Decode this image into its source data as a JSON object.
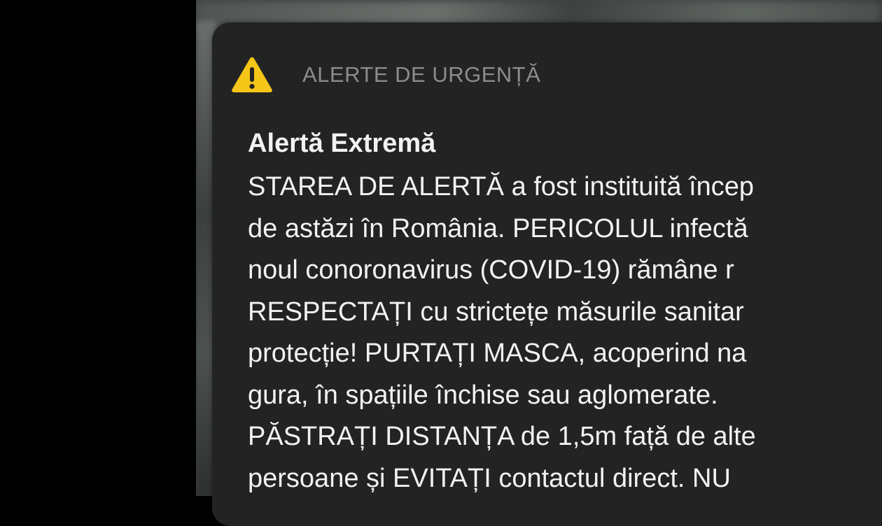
{
  "notification": {
    "app_name": "ALERTE DE URGENȚĂ",
    "icon": "warning-triangle-icon",
    "accent_color": "#f5c518",
    "title": "Alertă Extremă",
    "body_lines": [
      "STAREA DE ALERTĂ a fost instituită încep",
      "de astăzi în România. PERICOLUL infectă",
      "noul conoronavirus (COVID-19) rămâne r",
      "RESPECTAȚI cu strictețe măsurile sanitar",
      "protecție! PURTAȚI MASCA, acoperind na",
      "gura, în spațiile închise sau aglomerate.",
      "PĂSTRAȚI DISTANȚA de 1,5m față de alte",
      "persoane și EVITAȚI contactul direct. NU"
    ]
  }
}
